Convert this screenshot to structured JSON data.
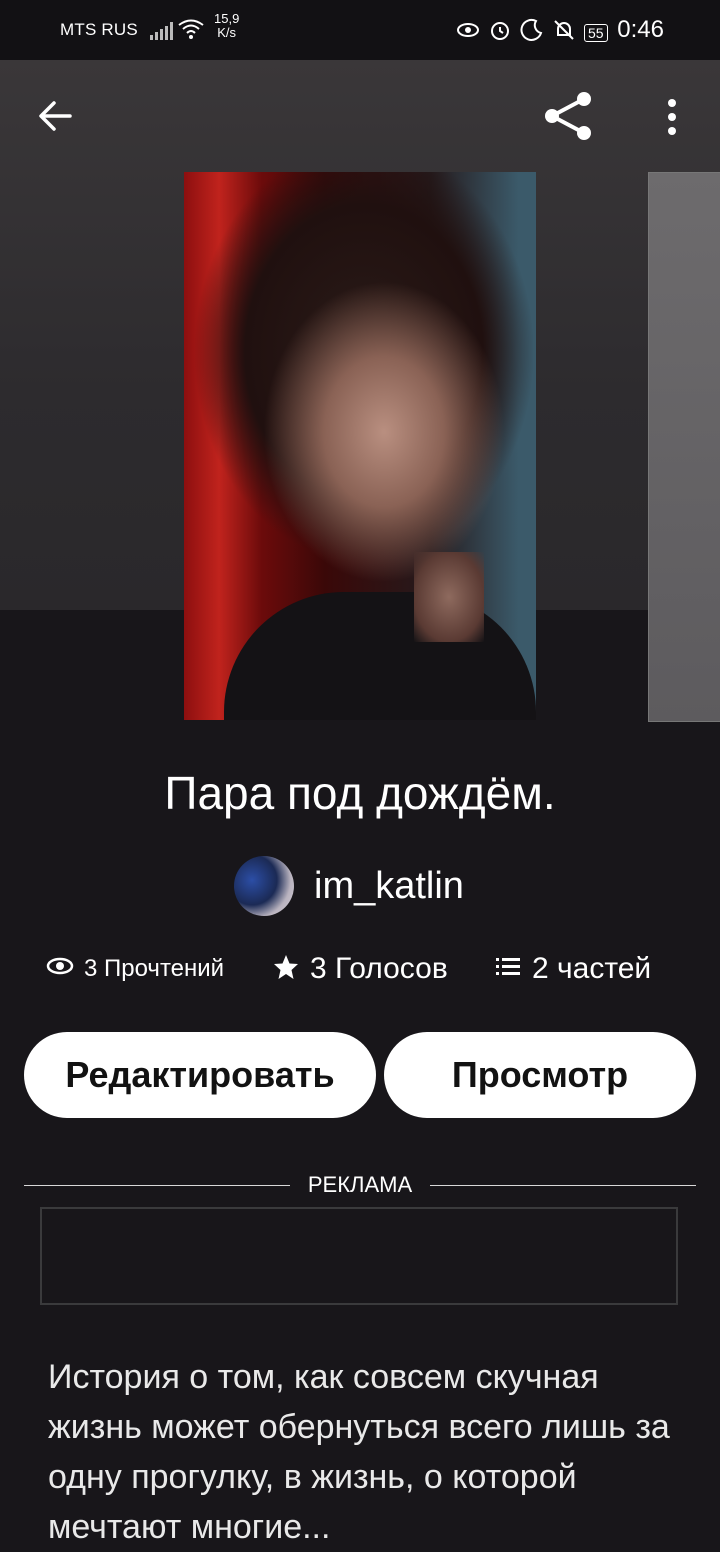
{
  "status_bar": {
    "carrier": "MTS RUS",
    "net_speed_value": "15,9",
    "net_speed_unit": "K/s",
    "battery": "55",
    "time": "0:46"
  },
  "story": {
    "title": "Пара под дождём.",
    "author": "im_katlin",
    "reads": "3 Прочтений",
    "votes": "3 Голосов",
    "parts": "2 частей",
    "description": "История о том, как совсем скучная жизнь может обернуться всего лишь за одну прогулку, в жизнь, о которой мечтают многие..."
  },
  "actions": {
    "edit_label": "Редактировать",
    "view_label": "Просмотр"
  },
  "ad": {
    "label": "РЕКЛАМА"
  },
  "icons": {
    "back": "arrow-left-icon",
    "share": "share-icon",
    "more": "more-vertical-icon",
    "reads": "eye-icon",
    "votes": "star-icon",
    "parts": "list-icon"
  }
}
